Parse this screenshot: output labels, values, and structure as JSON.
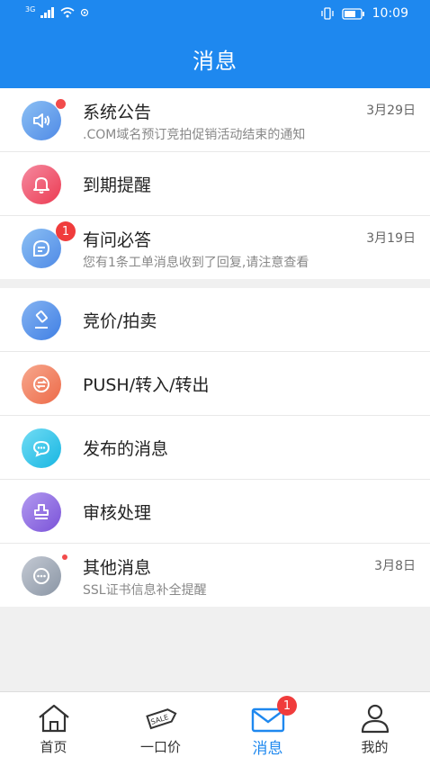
{
  "status_bar": {
    "time": "10:09",
    "network": "3G"
  },
  "header": {
    "title": "消息"
  },
  "section1": [
    {
      "name": "系统公告",
      "desc": ".COM域名预订竞拍促销活动结束的通知",
      "date": "3月29日",
      "icon": "speaker-icon",
      "color": "#5b9fe8"
    },
    {
      "name": "到期提醒",
      "icon": "bell-icon",
      "color": "#f04a5e"
    },
    {
      "name": "有问必答",
      "desc": "您有1条工单消息收到了回复,请注意查看",
      "date": "3月19日",
      "badge": "1",
      "icon": "chat-icon",
      "color": "#5b9fe8"
    }
  ],
  "section2": [
    {
      "name": "竞价/拍卖",
      "icon": "gavel-icon",
      "color": "#4f8ae6"
    },
    {
      "name": "PUSH/转入/转出",
      "icon": "transfer-icon",
      "color": "#f07a5a"
    },
    {
      "name": "发布的消息",
      "icon": "message-icon",
      "color": "#2cc4e8"
    },
    {
      "name": "审核处理",
      "icon": "stamp-icon",
      "color": "#8a66e0"
    },
    {
      "name": "其他消息",
      "desc": "SSL证书信息补全提醒",
      "date": "3月8日",
      "icon": "more-icon",
      "color": "#a0aab6"
    }
  ],
  "tabbar": {
    "tabs": [
      {
        "label": "首页",
        "icon": "home-icon"
      },
      {
        "label": "一口价",
        "icon": "sale-tag-icon",
        "tag_text": "SALE"
      },
      {
        "label": "消息",
        "icon": "mail-icon",
        "badge": "1",
        "active": true
      },
      {
        "label": "我的",
        "icon": "user-icon"
      }
    ]
  },
  "colors": {
    "primary": "#1e88ef",
    "badge": "#f03c3c"
  }
}
